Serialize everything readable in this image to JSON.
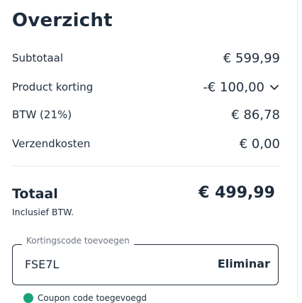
{
  "summary": {
    "title": "Overzicht",
    "rows": [
      {
        "label": "Subtotaal",
        "value": "€ 599,99"
      },
      {
        "label": "Product korting",
        "value": "-€ 100,00"
      },
      {
        "label": "BTW (21%)",
        "value": "€ 86,78"
      },
      {
        "label": "Verzendkosten",
        "value": "€ 0,00"
      }
    ],
    "total": {
      "label": "Totaal",
      "value": "€ 499,99",
      "note": "Inclusief BTW."
    }
  },
  "discount": {
    "legend": "Kortingscode toevoegen",
    "value": "FSE7L",
    "action": "Eliminar",
    "hint": "Coupon code toegevoegd"
  },
  "icons": {
    "discount_toggle": "chevron-down-icon",
    "status": "check-circle-icon"
  },
  "colors": {
    "text": "#1f2d3d",
    "accent": "#1aa37a",
    "divider": "#e6e8eb"
  }
}
